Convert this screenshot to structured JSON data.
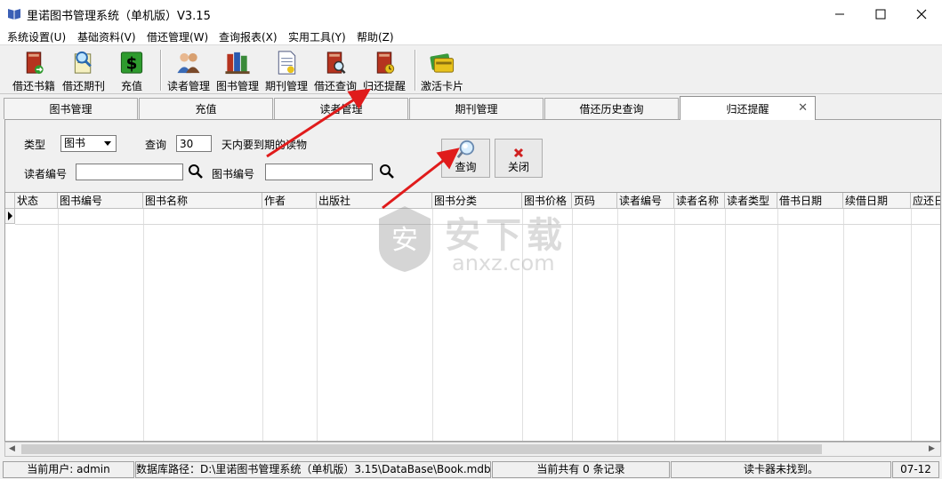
{
  "window": {
    "title": "里诺图书管理系统（单机版）V3.15"
  },
  "menu": [
    "系统设置(U)",
    "基础资料(V)",
    "借还管理(W)",
    "查询报表(X)",
    "实用工具(Y)",
    "帮助(Z)"
  ],
  "toolbar": {
    "borrow_books": "借还书籍",
    "borrow_periodicals": "借还期刊",
    "recharge": "充值",
    "reader_mgmt": "读者管理",
    "book_mgmt": "图书管理",
    "periodical_mgmt": "期刊管理",
    "borrow_query": "借还查询",
    "return_reminder": "归还提醒",
    "activate_card": "激活卡片"
  },
  "tabs": [
    "图书管理",
    "充值",
    "读者管理",
    "期刊管理",
    "借还历史查询",
    "归还提醒"
  ],
  "filters": {
    "type_label": "类型",
    "type_value": "图书",
    "query_label": "查询",
    "days_value": "30",
    "days_suffix": "天内要到期的读物",
    "reader_no_label": "读者编号",
    "reader_no_value": "",
    "book_no_label": "图书编号",
    "book_no_value": "",
    "query_button": "查询",
    "close_button": "关闭"
  },
  "table": {
    "columns": [
      "状态",
      "图书编号",
      "图书名称",
      "作者",
      "出版社",
      "图书分类",
      "图书价格",
      "页码",
      "读者编号",
      "读者名称",
      "读者类型",
      "借书日期",
      "续借日期",
      "应还日"
    ]
  },
  "status": {
    "user": "当前用户: admin",
    "db_path": "数据库路径：D:\\里诺图书管理系统（单机版）3.15\\DataBase\\Book.mdb",
    "records": "当前共有 0 条记录",
    "card_reader": "读卡器未找到。",
    "date": "07-12"
  },
  "watermark": {
    "big": "安下载",
    "small": "anxz.com"
  },
  "colors": {
    "arrow": "#e01b1b",
    "book_red": "#b5331f",
    "money_green": "#2e9b2e",
    "card_yellow": "#e8c21c"
  }
}
